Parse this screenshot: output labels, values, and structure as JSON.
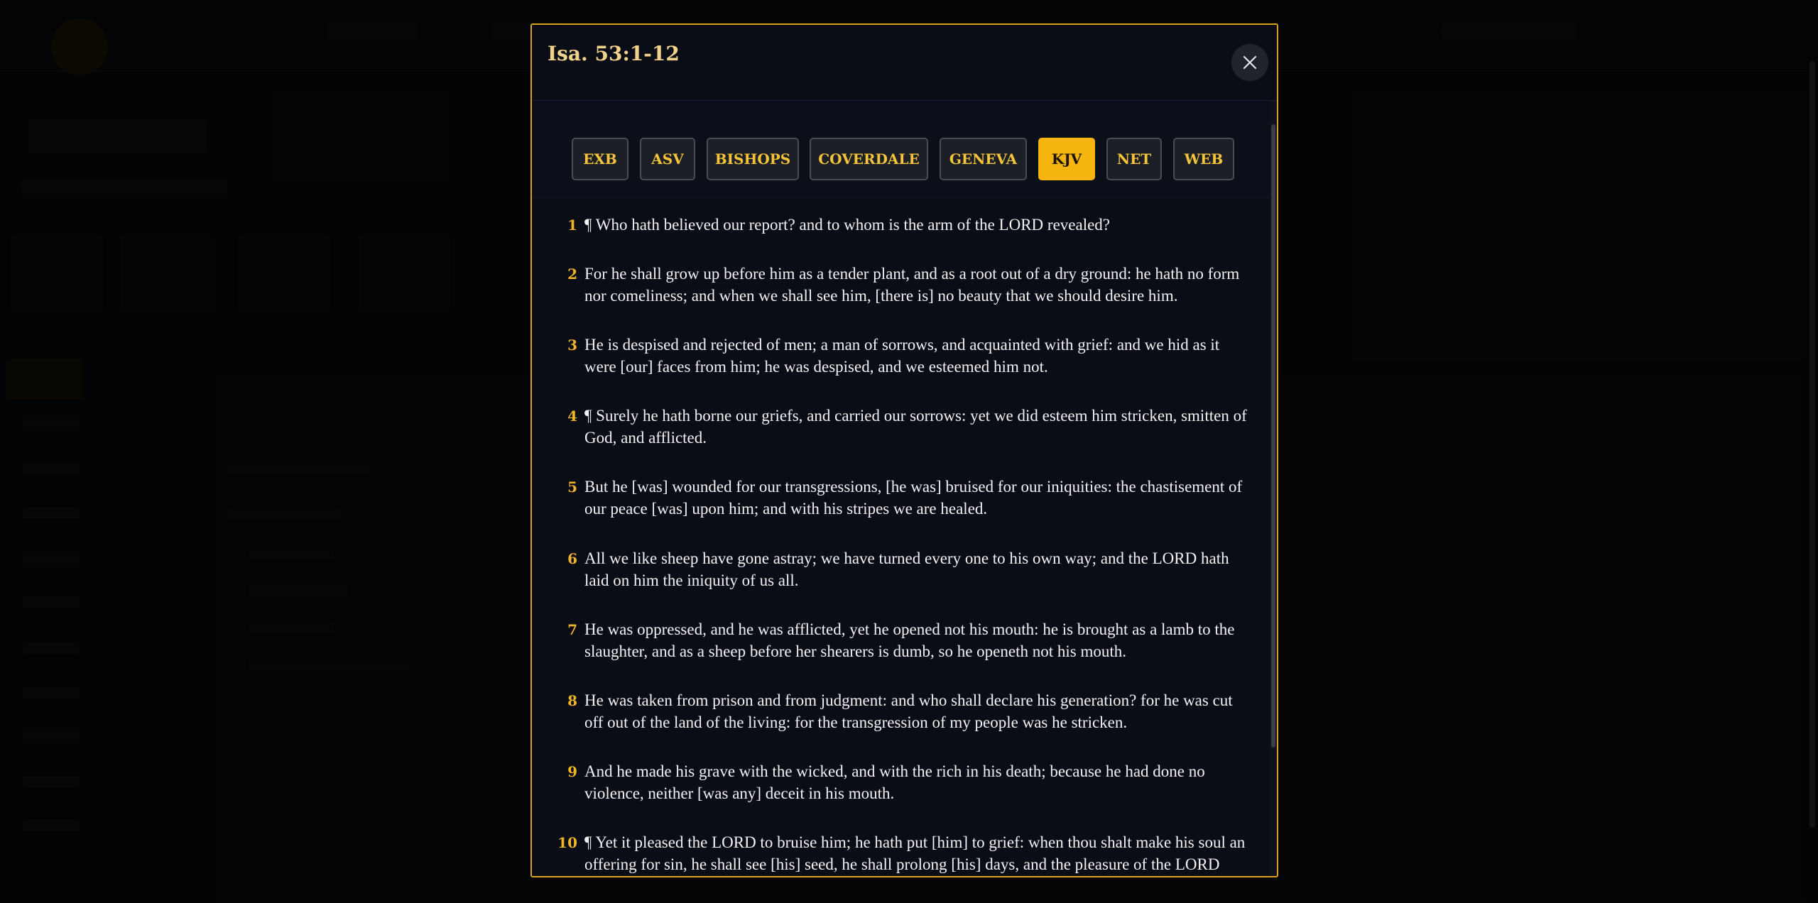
{
  "modal": {
    "title": "Isa. 53:1-12",
    "close_icon": "close-icon"
  },
  "versions": [
    {
      "label": "EXB",
      "active": false
    },
    {
      "label": "ASV",
      "active": false
    },
    {
      "label": "BISHOPS",
      "active": false
    },
    {
      "label": "COVERDALE",
      "active": false
    },
    {
      "label": "GENEVA",
      "active": false
    },
    {
      "label": "KJV",
      "active": true
    },
    {
      "label": "NET",
      "active": false
    },
    {
      "label": "WEB",
      "active": false
    }
  ],
  "verses": [
    {
      "num": "1",
      "text": "¶ Who hath believed our report? and to whom is the arm of the LORD revealed?"
    },
    {
      "num": "2",
      "text": "For he shall grow up before him as a tender plant, and as a root out of a dry ground: he hath no form nor comeliness; and when we shall see him, [there is] no beauty that we should desire him."
    },
    {
      "num": "3",
      "text": "He is despised and rejected of men; a man of sorrows, and acquainted with grief: and we hid as it were [our] faces from him; he was despised, and we esteemed him not."
    },
    {
      "num": "4",
      "text": "¶ Surely he hath borne our griefs, and carried our sorrows: yet we did esteem him stricken, smitten of God, and afflicted."
    },
    {
      "num": "5",
      "text": "But he [was] wounded for our transgressions, [he was] bruised for our iniquities: the chastisement of our peace [was] upon him; and with his stripes we are healed."
    },
    {
      "num": "6",
      "text": "All we like sheep have gone astray; we have turned every one to his own way; and the LORD hath laid on him the iniquity of us all."
    },
    {
      "num": "7",
      "text": "He was oppressed, and he was afflicted, yet he opened not his mouth: he is brought as a lamb to the slaughter, and as a sheep before her shearers is dumb, so he openeth not his mouth."
    },
    {
      "num": "8",
      "text": "He was taken from prison and from judgment: and who shall declare his generation? for he was cut off out of the land of the living: for the transgression of my people was he stricken."
    },
    {
      "num": "9",
      "text": "And he made his grave with the wicked, and with the rich in his death; because he had done no violence, neither [was any] deceit in his mouth."
    },
    {
      "num": "10",
      "text": "¶ Yet it pleased the LORD to bruise him; he hath put [him] to grief: when thou shalt make his soul an offering for sin, he shall see [his] seed, he shall prolong [his] days, and the pleasure of the LORD shall prosper in his hand."
    }
  ],
  "colors": {
    "accent": "#f6b50e",
    "modal_border": "#d8a11f",
    "verse_number": "#f0b32a",
    "title": "#f0d28a"
  }
}
